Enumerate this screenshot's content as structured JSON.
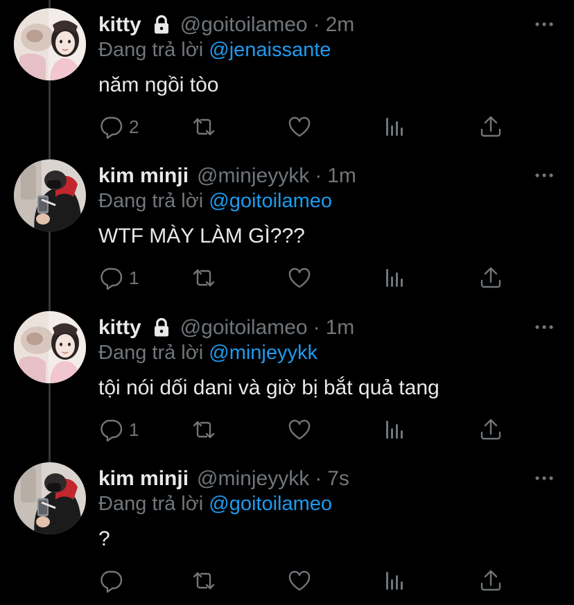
{
  "reply_prefix": "Đang trả lời",
  "colors": {
    "background": "#000000",
    "text": "#e7e9ea",
    "secondary": "#71767b",
    "mention": "#1d9bf0",
    "thread_line": "#333639"
  },
  "icons": {
    "lock": "lock-icon",
    "more": "more-horizontal-icon",
    "reply": "reply-icon",
    "retweet": "retweet-icon",
    "like": "heart-icon",
    "views": "analytics-icon",
    "share": "share-icon"
  },
  "tweets": [
    {
      "name": "kitty",
      "protected": true,
      "handle": "@goitoilameo",
      "separator": "·",
      "time": "2m",
      "replying_to": "@jenaissante",
      "text": "năm ngồi tòo",
      "reply_count": "2",
      "avatar": "avatar-kitty"
    },
    {
      "name": "kim minji",
      "protected": false,
      "handle": "@minjeyykk",
      "separator": "·",
      "time": "1m",
      "replying_to": "@goitoilameo",
      "text": "WTF MÀY LÀM GÌ???",
      "reply_count": "1",
      "avatar": "avatar-minji"
    },
    {
      "name": "kitty",
      "protected": true,
      "handle": "@goitoilameo",
      "separator": "·",
      "time": "1m",
      "replying_to": "@minjeyykk",
      "text": "tội nói dối dani và giờ bị bắt quả tang",
      "reply_count": "1",
      "avatar": "avatar-kitty"
    },
    {
      "name": "kim minji",
      "protected": false,
      "handle": "@minjeyykk",
      "separator": "·",
      "time": "7s",
      "replying_to": "@goitoilameo",
      "text": "?",
      "reply_count": "",
      "avatar": "avatar-minji"
    }
  ]
}
